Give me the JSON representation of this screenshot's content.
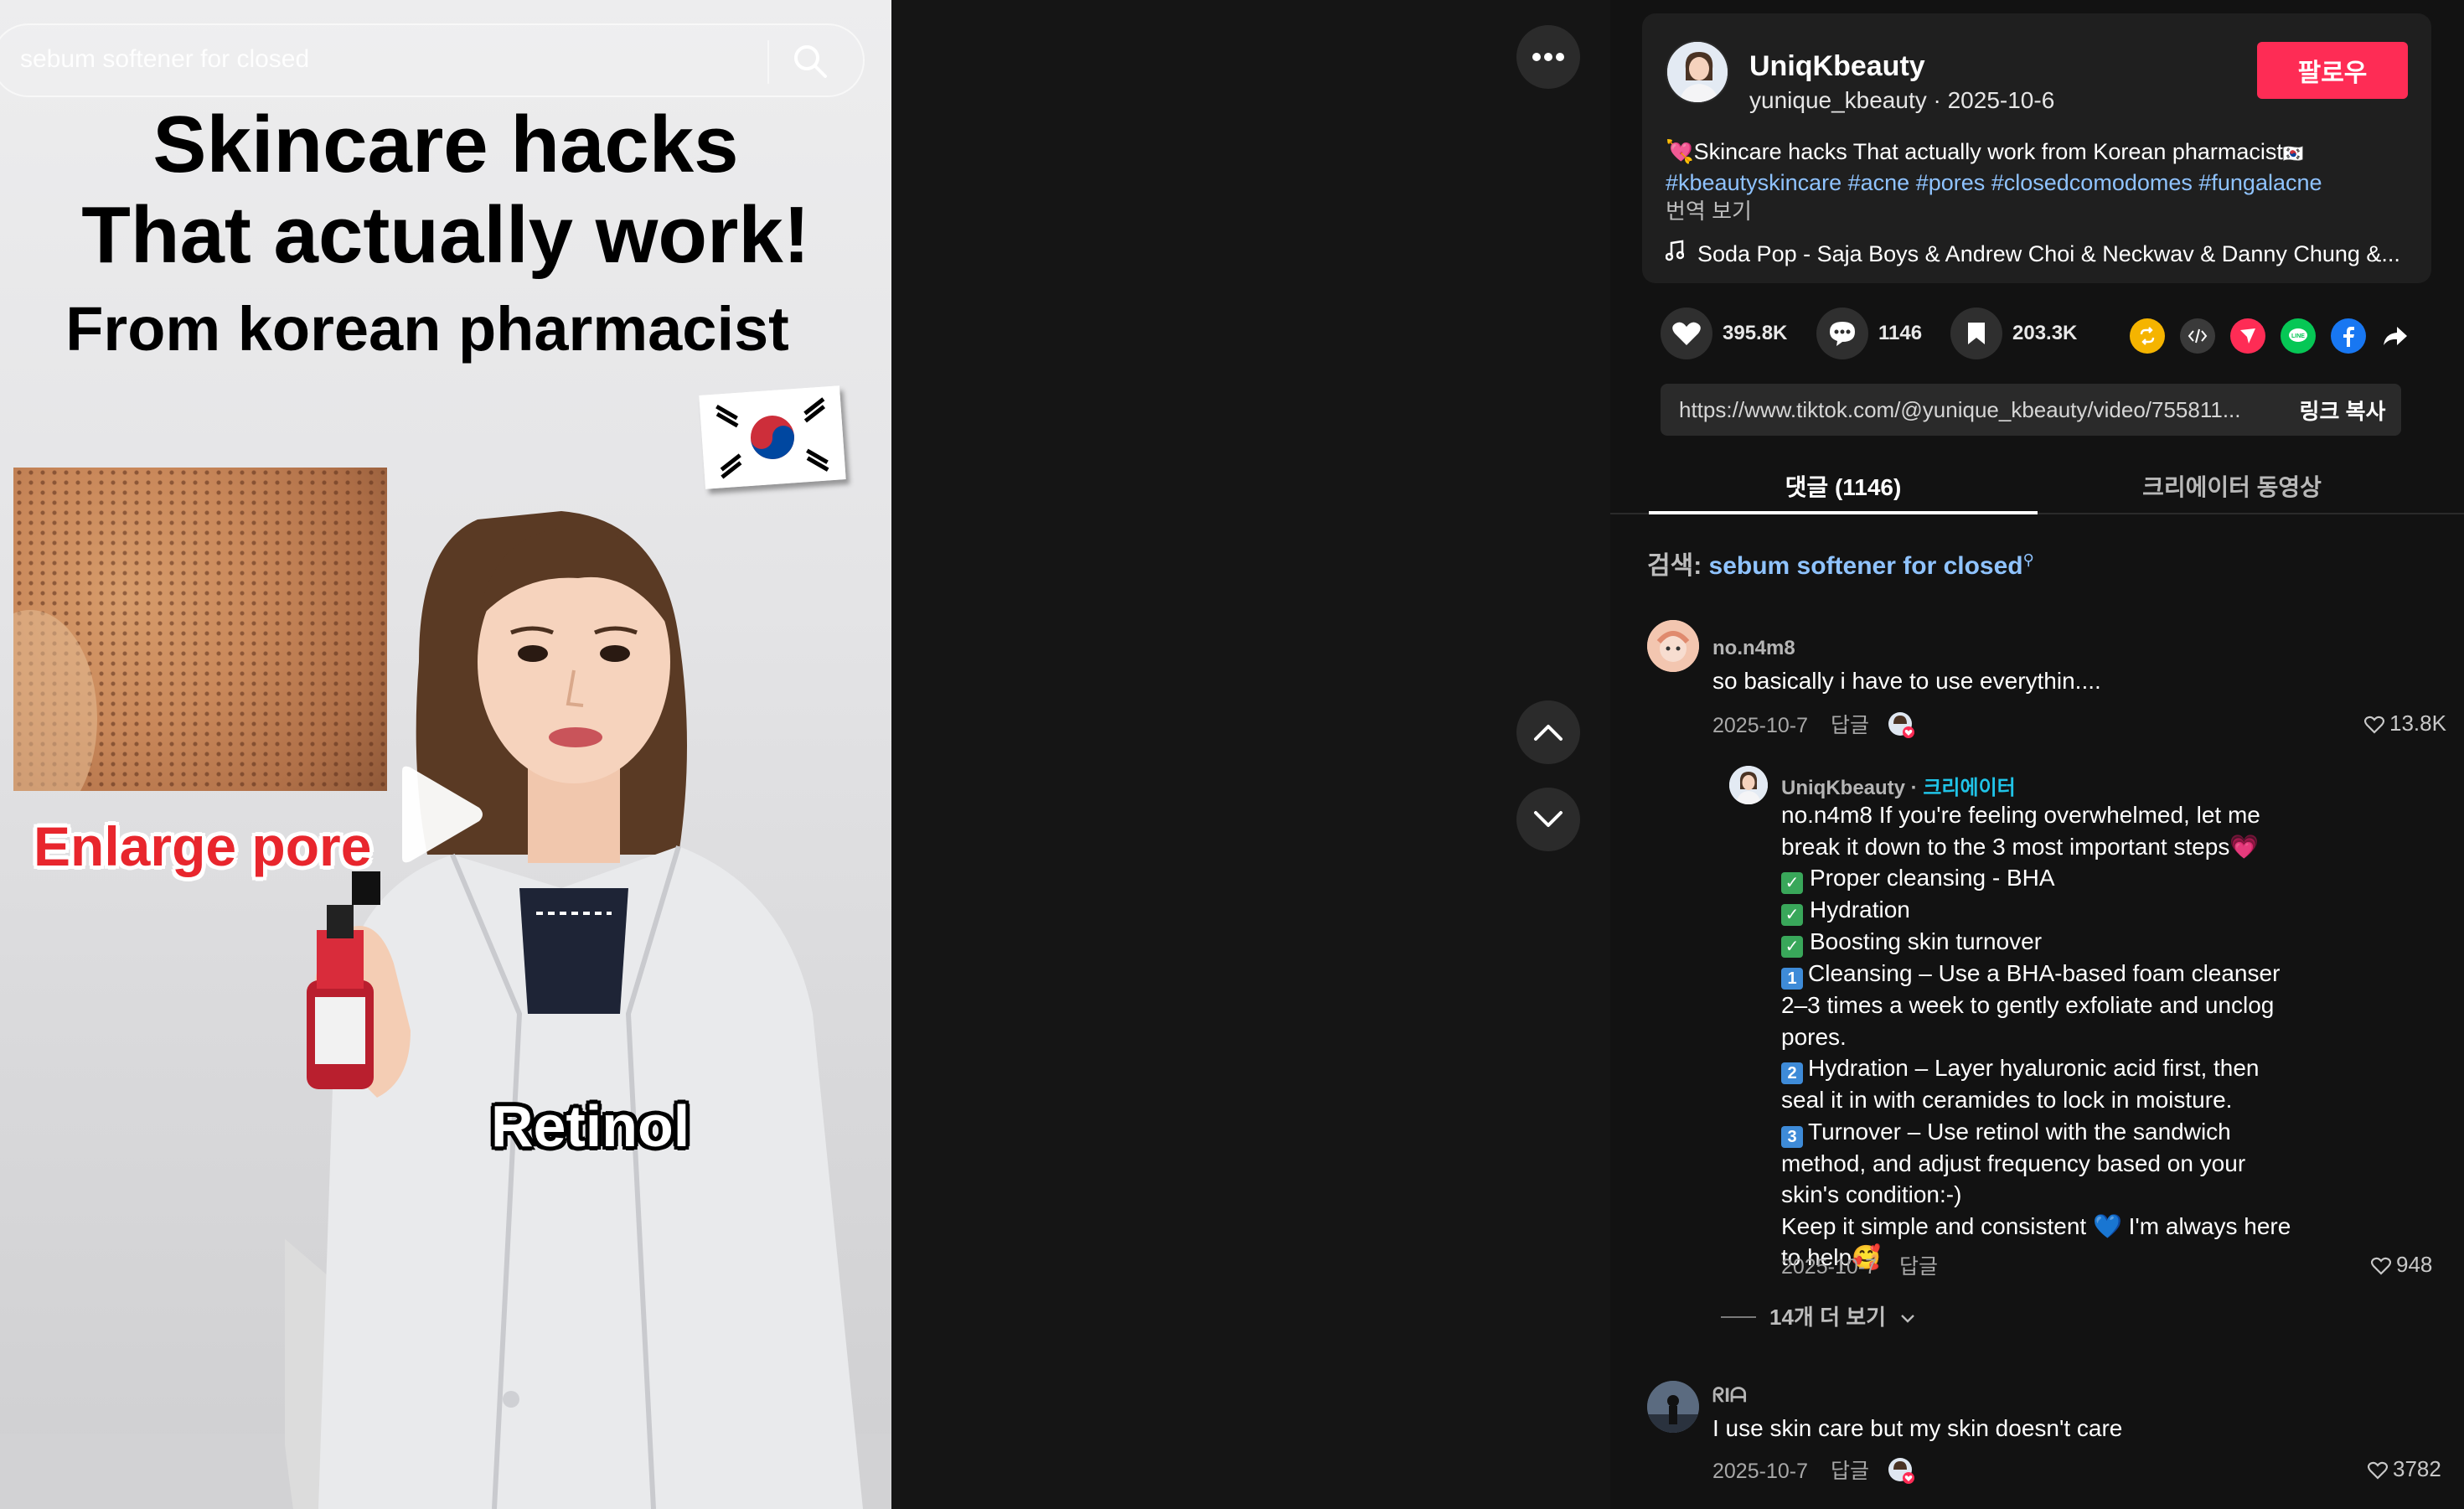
{
  "search": {
    "query": "sebum softener for closed"
  },
  "video": {
    "title_line1": "Skincare hacks",
    "title_line2": "That actually work!",
    "title_line3": "From korean pharmacist",
    "label_enlarge_pore": "Enlarge pore",
    "label_retinol": "Retinol"
  },
  "author": {
    "name": "UniqKbeauty",
    "meta": "yunique_kbeauty · 2025-10-6",
    "follow_label": "팔로우"
  },
  "caption": {
    "heart_emoji": "💘",
    "text": "Skincare hacks That actually work from Korean pharmacist",
    "flag_emoji": "🇰🇷",
    "hashtags": "#kbeautyskincare #acne #pores #closedcomodomes #fungalacne",
    "translate_label": "번역 보기"
  },
  "music": {
    "title": "Soda Pop - Saja Boys & Andrew Choi & Neckwav & Danny Chung &..."
  },
  "stats": {
    "likes": "395.8K",
    "comments": "1146",
    "saves": "203.3K"
  },
  "share": {
    "icons": [
      "repost-icon",
      "embed-icon",
      "send-icon",
      "line-icon",
      "facebook-icon",
      "share-arrow-icon"
    ]
  },
  "link": {
    "url": "https://www.tiktok.com/@yunique_kbeauty/video/755811...",
    "copy_label": "링크 복사"
  },
  "tabs": {
    "comments": "댓글 (1146)",
    "creator_videos": "크리에이터 동영상"
  },
  "comment_search": {
    "label": "검색: ",
    "term": "sebum softener for closed"
  },
  "comments": [
    {
      "user": "no.n4m8",
      "text": "so basically i have to use everythin....",
      "date": "2025-10-7",
      "reply_label": "답글",
      "likes": "13.8K"
    },
    {
      "user": "UniqKbeauty",
      "creator_label": "크리에이터",
      "intro": "no.n4m8 If you're feeling overwhelmed, let me break it down to the 3 most important steps",
      "intro_emoji": "💗",
      "check1": "Proper cleansing - BHA",
      "check2": "Hydration",
      "check3": "Boosting skin turnover",
      "step1": "Cleansing – Use a BHA-based foam cleanser 2–3 times a week to gently exfoliate and unclog pores.",
      "step2": "Hydration – Layer hyaluronic acid first, then seal it in with ceramides to lock in moisture.",
      "step3": "Turnover – Use retinol with the sandwich method, and adjust frequency based on your skin's condition:-)",
      "outro": "Keep it simple and consistent",
      "outro_emoji1": "💙",
      "outro_mid": " I'm always here to help",
      "outro_emoji2": "🥰",
      "date": "2025-10-7",
      "reply_label": "답글",
      "likes": "948"
    },
    {
      "user": "ᖇIᗩ",
      "text": "I use skin care but my skin doesn't care",
      "date": "2025-10-7",
      "reply_label": "답글",
      "likes": "3782"
    }
  ],
  "view_more": "14개 더 보기",
  "colors": {
    "follow": "#fe2c55",
    "hashtag": "#8fc3ff",
    "creator_tag": "#20c4e8",
    "enlarge_label": "#e8262d"
  }
}
